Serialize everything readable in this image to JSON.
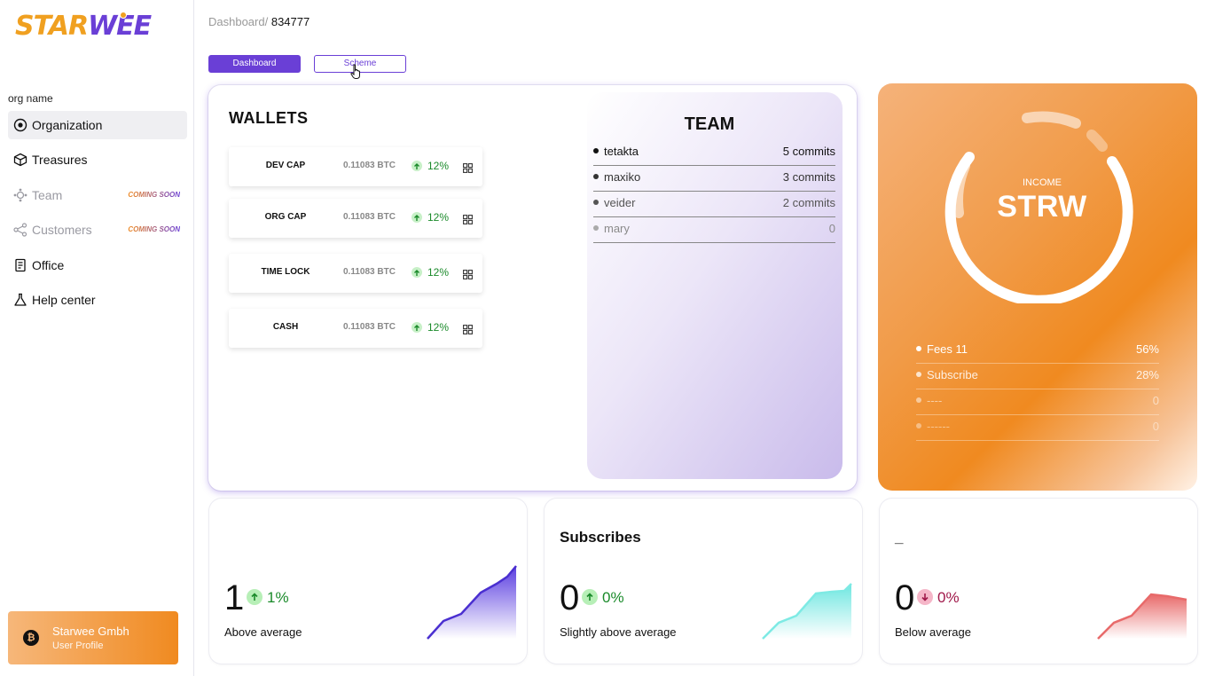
{
  "brand": {
    "logo_a": "STAR",
    "logo_b": "WEE"
  },
  "sidebar": {
    "org_label": "org name",
    "items": [
      {
        "label": "Organization",
        "icon": "target-icon",
        "active": true,
        "soon": ""
      },
      {
        "label": "Treasures",
        "icon": "cube-icon",
        "active": false,
        "soon": ""
      },
      {
        "label": "Team",
        "icon": "team-icon",
        "active": false,
        "soon": "COMING SOON"
      },
      {
        "label": "Customers",
        "icon": "share-icon",
        "active": false,
        "soon": "COMING SOON"
      },
      {
        "label": "Office",
        "icon": "document-icon",
        "active": false,
        "soon": ""
      },
      {
        "label": "Help center",
        "icon": "flask-icon",
        "active": false,
        "soon": ""
      }
    ],
    "profile": {
      "name": "Starwee Gmbh",
      "role": "User Profile",
      "icon": "bitcoin-icon"
    }
  },
  "header": {
    "crumb_root": "Dashboard/",
    "crumb_current": "834777",
    "dashboard_btn": "Dashboard",
    "scheme_btn": "Scheme"
  },
  "wallets": {
    "title": "WALLETS",
    "items": [
      {
        "name": "DEV CAP",
        "value": "0.11083 BTC",
        "pct": "12%"
      },
      {
        "name": "ORG CAP",
        "value": "0.11083 BTC",
        "pct": "12%"
      },
      {
        "name": "TIME LOCK",
        "value": "0.11083 BTC",
        "pct": "12%"
      },
      {
        "name": "CASH",
        "value": "0.11083 BTC",
        "pct": "12%"
      }
    ]
  },
  "team": {
    "title": "TEAM",
    "members": [
      {
        "name": "tetakta",
        "commits": "5 commits"
      },
      {
        "name": "maxiko",
        "commits": "3 commits"
      },
      {
        "name": "veider",
        "commits": "2 commits"
      },
      {
        "name": "mary",
        "commits": "0"
      }
    ]
  },
  "income": {
    "label": "INCOME",
    "value": "STRW",
    "rows": [
      {
        "name": "Fees 11",
        "pct": "56%"
      },
      {
        "name": "Subscribe",
        "pct": "28%"
      },
      {
        "name": "----",
        "pct": "0"
      },
      {
        "name": "------",
        "pct": "0"
      }
    ]
  },
  "stats": [
    {
      "title": "",
      "value": "1",
      "pct": "1%",
      "trend": "up",
      "desc": "Above average",
      "color": "#5b3ee0"
    },
    {
      "title": "Subscribes",
      "value": "0",
      "pct": "0%",
      "trend": "up",
      "desc": "Slightly above average",
      "color": "#6ee6e0"
    },
    {
      "title": "_",
      "value": "0",
      "pct": "0%",
      "trend": "down",
      "desc": "Below average",
      "color": "#e86a6a"
    }
  ],
  "colors": {
    "accent": "#6a3fd6",
    "orange": "#f08a20",
    "positive": "#1a8a2a",
    "negative": "#a0184a"
  }
}
